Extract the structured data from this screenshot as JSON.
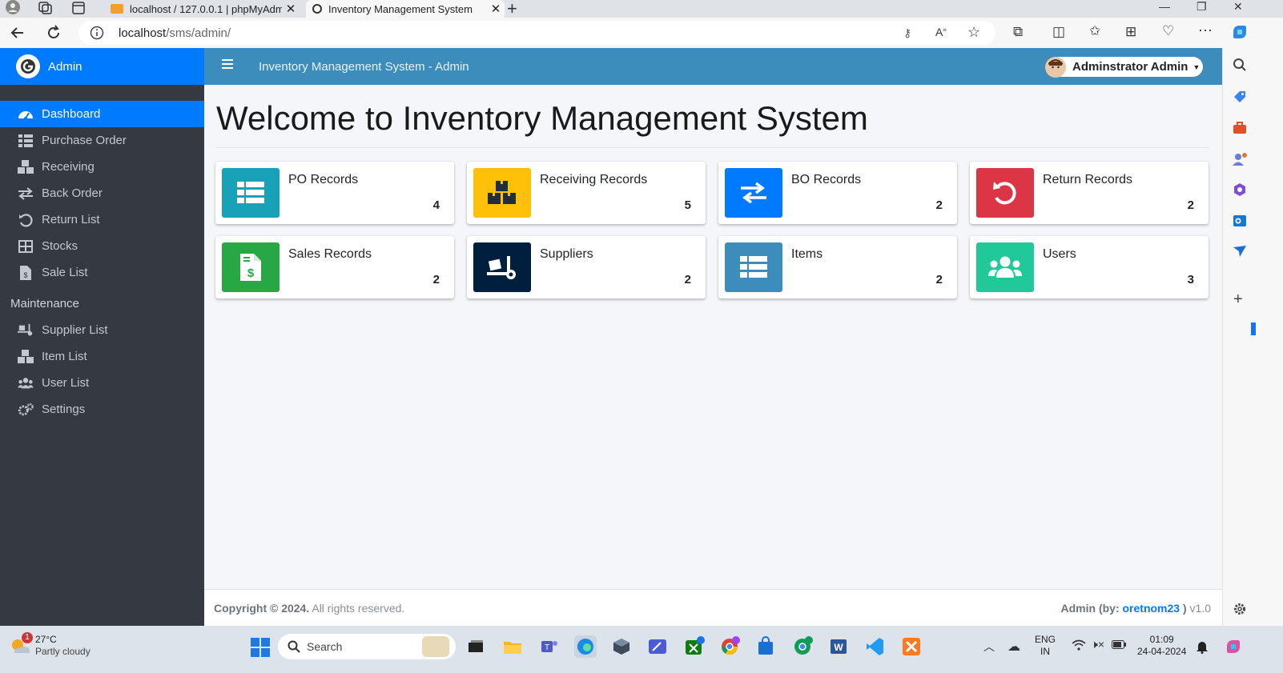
{
  "browser": {
    "tabs": [
      {
        "title": "localhost / 127.0.0.1 | phpMyAdm"
      },
      {
        "title": "Inventory Management System"
      }
    ],
    "url_host": "localhost",
    "url_path": "/sms/admin/"
  },
  "sidebar": {
    "brand": "Admin",
    "items": [
      {
        "label": "Dashboard",
        "icon": "dashboard-icon",
        "active": true
      },
      {
        "label": "Purchase Order",
        "icon": "table-list-icon"
      },
      {
        "label": "Receiving",
        "icon": "boxes-icon"
      },
      {
        "label": "Back Order",
        "icon": "exchange-icon"
      },
      {
        "label": "Return List",
        "icon": "undo-icon"
      },
      {
        "label": "Stocks",
        "icon": "grid-table-icon"
      },
      {
        "label": "Sale List",
        "icon": "invoice-icon"
      }
    ],
    "maintenance_header": "Maintenance",
    "maintenance_items": [
      {
        "label": "Supplier List",
        "icon": "truck-loading-icon"
      },
      {
        "label": "Item List",
        "icon": "boxes-icon"
      },
      {
        "label": "User List",
        "icon": "users-icon"
      },
      {
        "label": "Settings",
        "icon": "cogs-icon"
      }
    ]
  },
  "header": {
    "title": "Inventory Management System - Admin",
    "user": "Adminstrator Admin"
  },
  "main": {
    "page_title": "Welcome to Inventory Management System",
    "boxes": [
      {
        "label": "PO Records",
        "value": "4",
        "icon": "table-list-icon",
        "color": "#17a2b8"
      },
      {
        "label": "Receiving Records",
        "value": "5",
        "icon": "boxes-icon",
        "color": "#ffc107"
      },
      {
        "label": "BO Records",
        "value": "2",
        "icon": "exchange-icon",
        "color": "#007bff"
      },
      {
        "label": "Return Records",
        "value": "2",
        "icon": "undo-icon",
        "color": "#dc3545"
      },
      {
        "label": "Sales Records",
        "value": "2",
        "icon": "invoice-dollar-icon",
        "color": "#28a745"
      },
      {
        "label": "Suppliers",
        "value": "2",
        "icon": "truck-loading-icon",
        "color": "#001f3f"
      },
      {
        "label": "Items",
        "value": "2",
        "icon": "table-list-icon",
        "color": "#3c8dbc"
      },
      {
        "label": "Users",
        "value": "3",
        "icon": "users-icon",
        "color": "#20c997"
      }
    ]
  },
  "footer": {
    "copyright_bold": "Copyright © 2024.",
    "copyright_rest": " All rights reserved.",
    "credit_prefix": "Admin (by: ",
    "credit_author": "oretnom23",
    "credit_suffix": " )",
    "version": " v1.0"
  },
  "taskbar": {
    "weather_badge": "1",
    "temperature": "27°C",
    "condition": "Partly cloudy",
    "search": "Search",
    "lang": "ENG",
    "region": "IN",
    "time": "01:09",
    "date": "24-04-2024"
  }
}
